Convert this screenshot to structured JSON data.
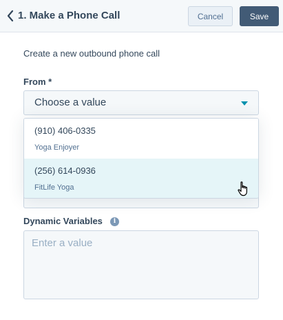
{
  "header": {
    "title": "1. Make a Phone Call",
    "cancel_label": "Cancel",
    "save_label": "Save"
  },
  "form": {
    "intro": "Create a new outbound phone call",
    "from_label": "From *",
    "from_select": {
      "value": "Choose a value",
      "options": [
        {
          "number": "(910) 406-0335",
          "name": "Yoga Enjoyer"
        },
        {
          "number": "(256) 614-0936",
          "name": "FitLife Yoga"
        }
      ],
      "hovered_option_index": 1
    },
    "dynamic_variables_label": "Dynamic Variables",
    "dynamic_variables_placeholder": "Enter a value"
  },
  "colors": {
    "header_bg": "#f5f8fa",
    "save_button_bg": "#425b76",
    "caret": "#0091ae",
    "hover_option_bg": "#e5f5f8",
    "info_icon": "#7c98b6"
  },
  "icons": {
    "back": "chevron-left-icon",
    "dropdown": "caret-down-icon",
    "info": "info-icon",
    "cursor": "hand-pointer-icon"
  }
}
